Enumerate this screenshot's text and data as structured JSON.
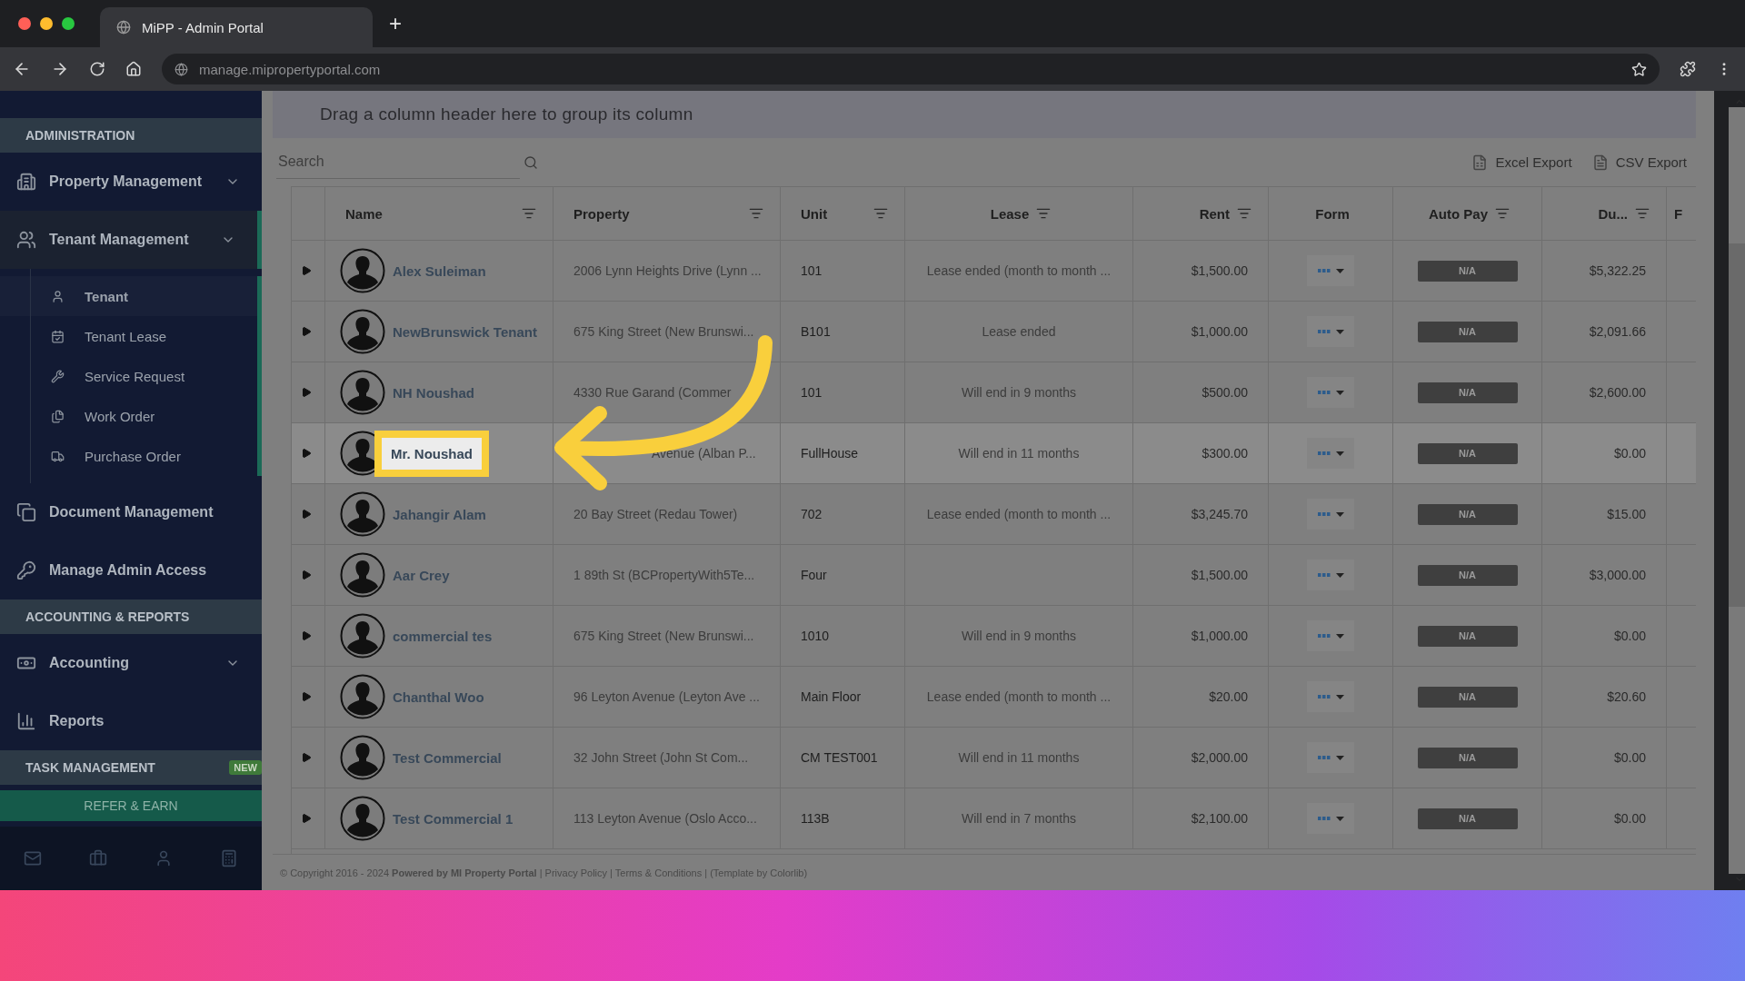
{
  "browser": {
    "tab_title": "MiPP - Admin Portal",
    "new_tab": "+",
    "url": "manage.mipropertyportal.com"
  },
  "sidebar": {
    "sections": [
      {
        "title": "ADMINISTRATION",
        "items": [
          {
            "label": "Property Management",
            "expandable": true,
            "selected": false
          },
          {
            "label": "Tenant Management",
            "expandable": true,
            "selected": true,
            "children": [
              {
                "label": "Tenant",
                "selected": true
              },
              {
                "label": "Tenant Lease",
                "selected": false
              },
              {
                "label": "Service Request",
                "selected": false
              },
              {
                "label": "Work Order",
                "selected": false
              },
              {
                "label": "Purchase Order",
                "selected": false
              }
            ]
          },
          {
            "label": "Document Management",
            "selected": false
          },
          {
            "label": "Manage Admin Access",
            "selected": false
          }
        ]
      },
      {
        "title": "ACCOUNTING & REPORTS",
        "items": [
          {
            "label": "Accounting",
            "expandable": true,
            "selected": false
          },
          {
            "label": "Reports",
            "selected": false
          }
        ]
      },
      {
        "title": "TASK MANAGEMENT",
        "badge": "NEW"
      }
    ],
    "cta": "REFER & EARN"
  },
  "group_panel": "Drag a column header here to group its column",
  "toolbar": {
    "search": {
      "placeholder": "Search"
    },
    "exports": [
      "Excel Export",
      "CSV Export"
    ]
  },
  "table": {
    "columns": [
      {
        "label": "Name",
        "filter": true
      },
      {
        "label": "Property",
        "filter": true
      },
      {
        "label": "Unit",
        "filter": true
      },
      {
        "label": "Lease",
        "filter": true
      },
      {
        "label": "Rent",
        "filter": true
      },
      {
        "label": "Form",
        "filter": false
      },
      {
        "label": "Auto Pay",
        "filter": true
      },
      {
        "label": "Du...",
        "filter": true
      },
      {
        "label": "F",
        "filter": false
      }
    ],
    "rows": [
      {
        "name": "Alex Suleiman",
        "property": "2006 Lynn Heights Drive (Lynn ...",
        "unit": "101",
        "lease": "Lease ended (month to month ...",
        "rent": "$1,500.00",
        "autopay": "N/A",
        "due": "$5,322.25",
        "highlighted": false
      },
      {
        "name": "NewBrunswick Tenant",
        "property": "675 King Street (New Brunswi...",
        "unit": "B101",
        "lease": "Lease ended",
        "rent": "$1,000.00",
        "autopay": "N/A",
        "due": "$2,091.66",
        "highlighted": false
      },
      {
        "name": "NH Noushad",
        "property": "4330 Rue Garand (Commer",
        "unit": "101",
        "lease": "Will end in 9 months",
        "rent": "$500.00",
        "autopay": "N/A",
        "due": "$2,600.00",
        "highlighted": false
      },
      {
        "name": "Mr. Noushad",
        "property": "Avenue (Alban P...",
        "unit": "FullHouse",
        "lease": "Will end in 11 months",
        "rent": "$300.00",
        "autopay": "N/A",
        "due": "$0.00",
        "highlighted": true
      },
      {
        "name": "Jahangir Alam",
        "property": "20 Bay Street (Redau Tower)",
        "unit": "702",
        "lease": "Lease ended (month to month ...",
        "rent": "$3,245.70",
        "autopay": "N/A",
        "due": "$15.00",
        "highlighted": false
      },
      {
        "name": "Aar Crey",
        "property": "1 89th St (BCPropertyWith5Te...",
        "unit": "Four",
        "rent": "$1,500.00",
        "autopay": "N/A",
        "due": "$3,000.00",
        "highlighted": false
      },
      {
        "name": "commercial tes",
        "property": "675 King Street (New Brunswi...",
        "unit": "1010",
        "lease": "Will end in 9 months",
        "rent": "$1,000.00",
        "autopay": "N/A",
        "due": "$0.00",
        "highlighted": false
      },
      {
        "name": "Chanthal Woo",
        "property": "96 Leyton Avenue (Leyton Ave ...",
        "unit": "Main Floor",
        "lease": "Lease ended (month to month ...",
        "rent": "$20.00",
        "autopay": "N/A",
        "due": "$20.60",
        "highlighted": false
      },
      {
        "name": "Test Commercial",
        "property": "32 John Street (John St Com...",
        "unit": "CM TEST001",
        "lease": "Will end in 11 months",
        "rent": "$2,000.00",
        "autopay": "N/A",
        "due": "$0.00",
        "highlighted": false
      },
      {
        "name": "Test Commercial 1",
        "property": "113 Leyton Avenue (Oslo Acco...",
        "unit": "113B",
        "lease": "Will end in 7 months",
        "rent": "$2,100.00",
        "autopay": "N/A",
        "due": "$0.00",
        "highlighted": false
      }
    ]
  },
  "footer": "© Copyright 2016 - 2024 **Powered by MI Property Portal** | Privacy Policy | Terms & Conditions | (Template by Colorlib)"
}
